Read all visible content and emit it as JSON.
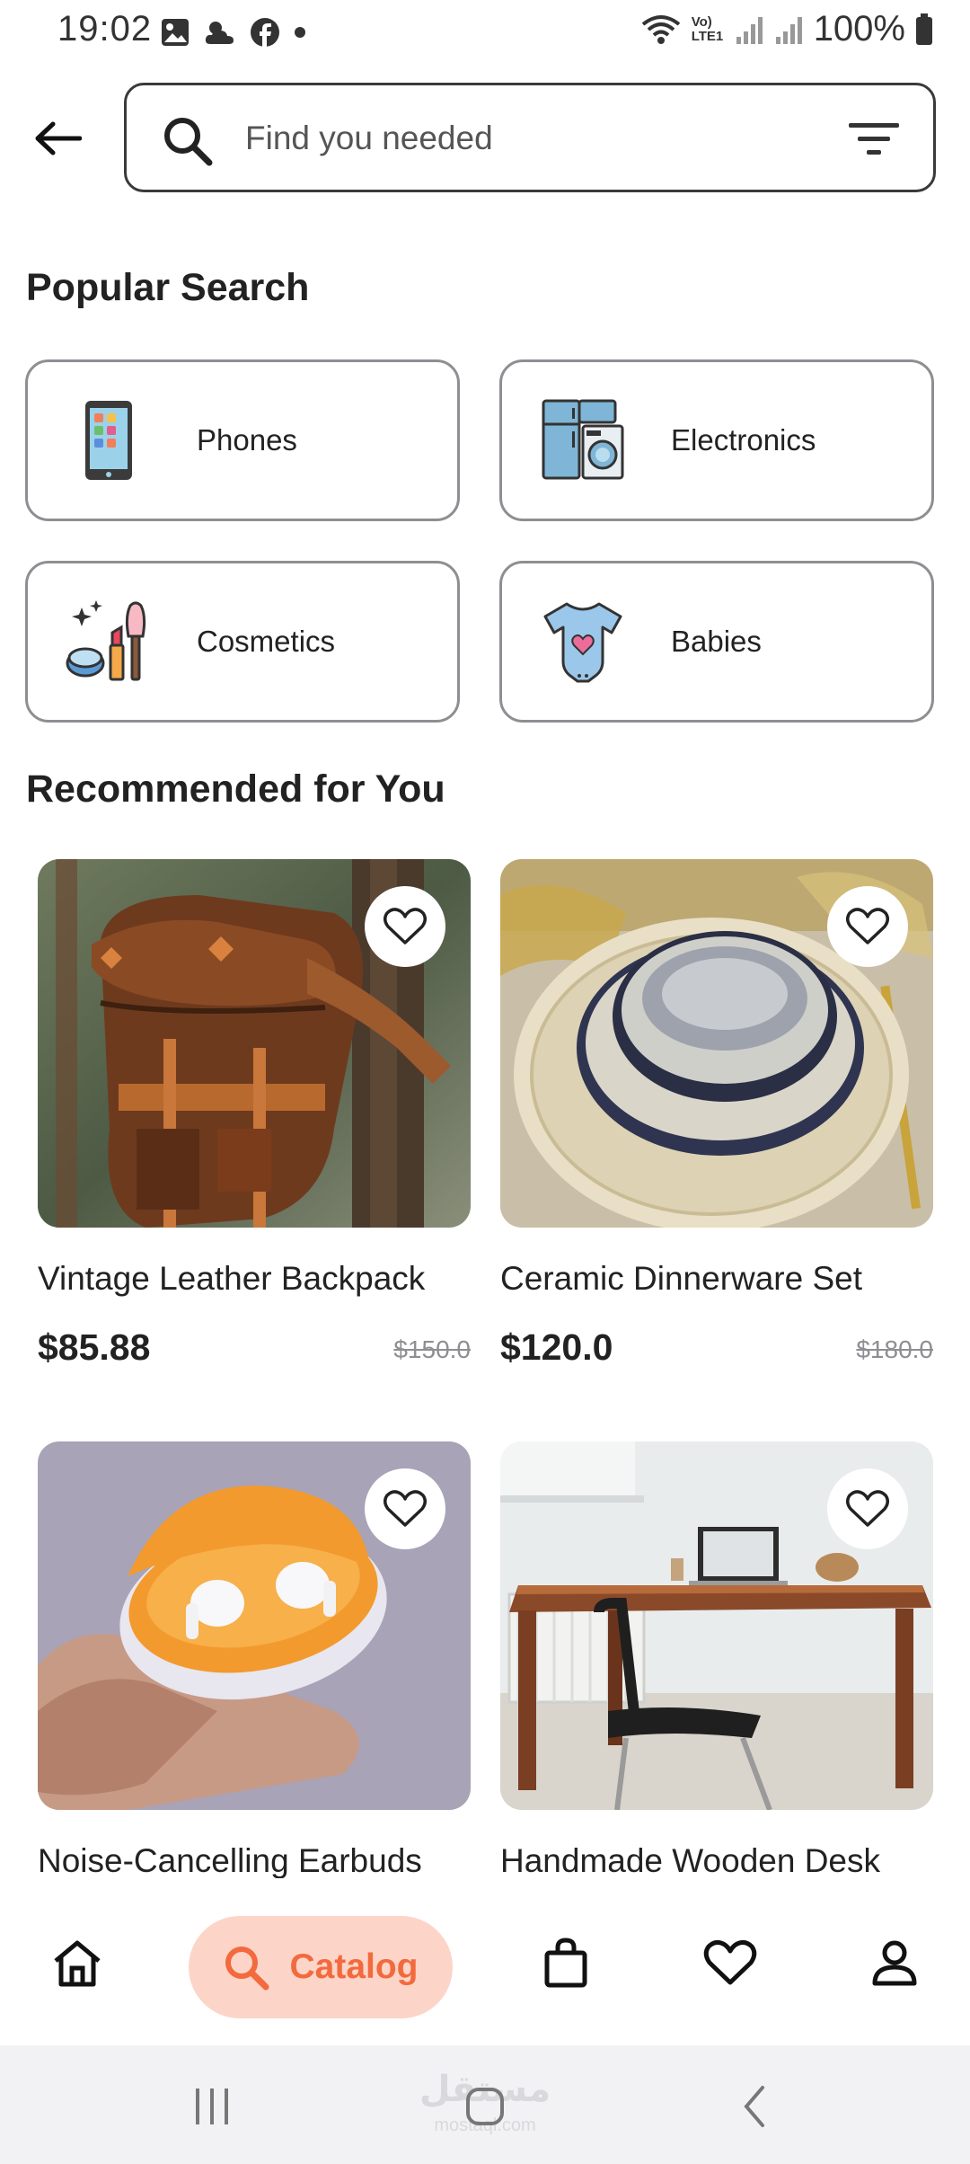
{
  "status_bar": {
    "time": "19:02",
    "battery": "100%",
    "network_label": "Vo) LTE1",
    "icons_left": [
      "gallery-icon",
      "weather-icon",
      "facebook-icon",
      "dot-icon"
    ],
    "icons_right": [
      "wifi-icon",
      "volte-icon",
      "signal-icon",
      "signal-icon",
      "battery-icon"
    ]
  },
  "search": {
    "placeholder": "Find you needed",
    "value": ""
  },
  "popular": {
    "title": "Popular Search",
    "categories": [
      {
        "label": "Phones",
        "icon": "phone-icon"
      },
      {
        "label": "Electronics",
        "icon": "appliances-icon"
      },
      {
        "label": "Cosmetics",
        "icon": "cosmetics-icon"
      },
      {
        "label": "Babies",
        "icon": "baby-onesie-icon"
      }
    ]
  },
  "recommended": {
    "title": "Recommended for You",
    "products": [
      {
        "title": "Vintage Leather Backpack",
        "price": "$85.88",
        "old_price": "$150.0"
      },
      {
        "title": "Ceramic Dinnerware Set",
        "price": "$120.0",
        "old_price": "$180.0"
      },
      {
        "title": "Noise-Cancelling Earbuds",
        "price": "",
        "old_price": ""
      },
      {
        "title": "Handmade Wooden Desk",
        "price": "",
        "old_price": ""
      }
    ]
  },
  "bottom_nav": {
    "active": "catalog",
    "catalog_label": "Catalog",
    "items": [
      "home-icon",
      "search-icon",
      "shopping-bag-icon",
      "heart-icon",
      "profile-icon"
    ]
  },
  "system_nav": {
    "watermark": "مستقل",
    "watermark_sub": "mostaql.com"
  },
  "colors": {
    "accent": "#f26a3d",
    "accent_bg": "#fdd5c8",
    "border": "#8e8e93",
    "text": "#222222"
  }
}
